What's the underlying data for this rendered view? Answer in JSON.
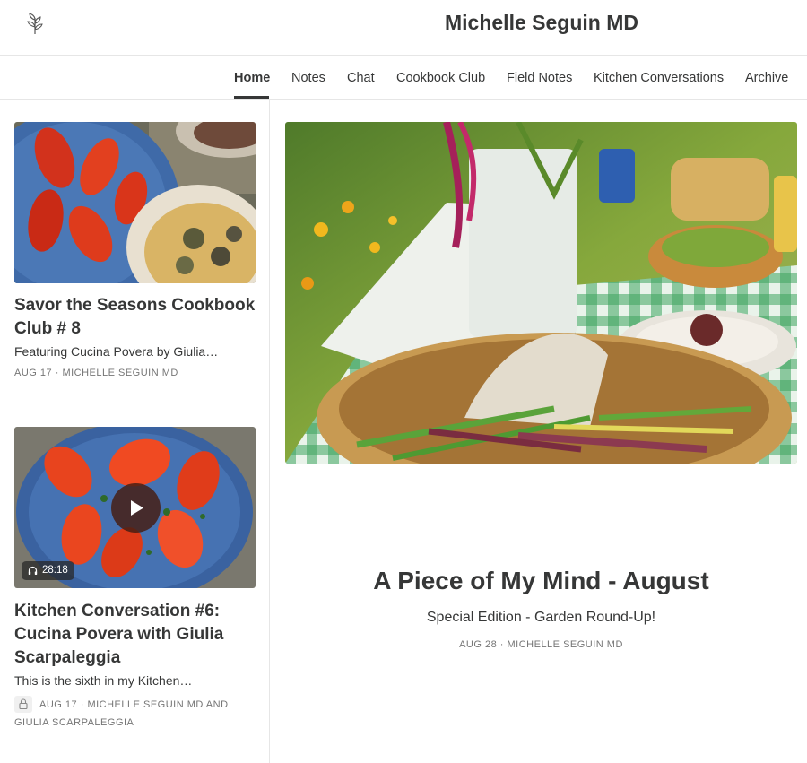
{
  "header": {
    "site_title": "Michelle Seguin MD",
    "logo_icon": "leaf-sprig-icon"
  },
  "nav": {
    "items": [
      {
        "label": "Home",
        "active": true
      },
      {
        "label": "Notes",
        "active": false
      },
      {
        "label": "Chat",
        "active": false
      },
      {
        "label": "Cookbook Club",
        "active": false
      },
      {
        "label": "Field Notes",
        "active": false
      },
      {
        "label": "Kitchen Conversations",
        "active": false
      },
      {
        "label": "Archive",
        "active": false
      }
    ]
  },
  "posts": [
    {
      "title": "Savor the Seasons Cookbook Club # 8",
      "subtitle": "Featuring Cucina Povera by Giulia…",
      "date": "AUG 17",
      "author": "MICHELLE SEGUIN MD"
    },
    {
      "title": "Kitchen Conversation #6: Cucina Povera with Giulia Scarpaleggia",
      "subtitle": "This is the sixth in my Kitchen…",
      "duration": "28:18",
      "date": "AUG 17",
      "author": "MICHELLE SEGUIN MD AND",
      "author_line2": "GIULIA SCARPALEGGIA",
      "locked": true
    }
  ],
  "featured": {
    "title": "A Piece of My Mind - August",
    "subtitle": "Special Edition - Garden Round-Up!",
    "date": "AUG 28",
    "author": "MICHELLE SEGUIN MD"
  },
  "colors": {
    "text": "#363737",
    "muted": "#757575",
    "border": "#e6e6e6",
    "play_button": "#5a2a1e"
  },
  "separator": "·"
}
